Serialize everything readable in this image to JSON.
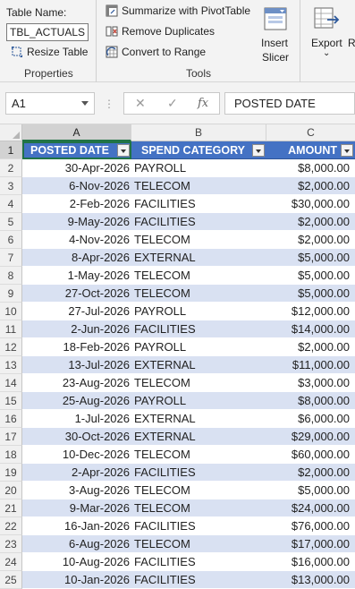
{
  "ribbon": {
    "properties": {
      "table_name_label": "Table Name:",
      "table_name_value": "TBL_ACTUALS",
      "resize_label": "Resize Table",
      "caption": "Properties"
    },
    "tools": {
      "pivot_label": "Summarize with PivotTable",
      "dupes_label": "Remove Duplicates",
      "range_label": "Convert to Range",
      "slicer_label_1": "Insert",
      "slicer_label_2": "Slicer",
      "caption": "Tools"
    },
    "export": {
      "export_label": "Export",
      "refresh_partial": "R"
    }
  },
  "formula_bar": {
    "name_box": "A1",
    "cancel_icon": "✕",
    "enter_icon": "✓",
    "fx_label": "fx",
    "content": "POSTED DATE"
  },
  "grid": {
    "columns": [
      "A",
      "B",
      "C"
    ],
    "header_row_num": "1",
    "headers": [
      "POSTED DATE",
      "SPEND CATEGORY",
      "AMOUNT"
    ],
    "rows": [
      {
        "num": "2",
        "date": "30-Apr-2026",
        "category": "PAYROLL",
        "amount": "$8,000.00"
      },
      {
        "num": "3",
        "date": "6-Nov-2026",
        "category": "TELECOM",
        "amount": "$2,000.00"
      },
      {
        "num": "4",
        "date": "2-Feb-2026",
        "category": "FACILITIES",
        "amount": "$30,000.00"
      },
      {
        "num": "5",
        "date": "9-May-2026",
        "category": "FACILITIES",
        "amount": "$2,000.00"
      },
      {
        "num": "6",
        "date": "4-Nov-2026",
        "category": "TELECOM",
        "amount": "$2,000.00"
      },
      {
        "num": "7",
        "date": "8-Apr-2026",
        "category": "EXTERNAL",
        "amount": "$5,000.00"
      },
      {
        "num": "8",
        "date": "1-May-2026",
        "category": "TELECOM",
        "amount": "$5,000.00"
      },
      {
        "num": "9",
        "date": "27-Oct-2026",
        "category": "TELECOM",
        "amount": "$5,000.00"
      },
      {
        "num": "10",
        "date": "27-Jul-2026",
        "category": "PAYROLL",
        "amount": "$12,000.00"
      },
      {
        "num": "11",
        "date": "2-Jun-2026",
        "category": "FACILITIES",
        "amount": "$14,000.00"
      },
      {
        "num": "12",
        "date": "18-Feb-2026",
        "category": "PAYROLL",
        "amount": "$2,000.00"
      },
      {
        "num": "13",
        "date": "13-Jul-2026",
        "category": "EXTERNAL",
        "amount": "$11,000.00"
      },
      {
        "num": "14",
        "date": "23-Aug-2026",
        "category": "TELECOM",
        "amount": "$3,000.00"
      },
      {
        "num": "15",
        "date": "25-Aug-2026",
        "category": "PAYROLL",
        "amount": "$8,000.00"
      },
      {
        "num": "16",
        "date": "1-Jul-2026",
        "category": "EXTERNAL",
        "amount": "$6,000.00"
      },
      {
        "num": "17",
        "date": "30-Oct-2026",
        "category": "EXTERNAL",
        "amount": "$29,000.00"
      },
      {
        "num": "18",
        "date": "10-Dec-2026",
        "category": "TELECOM",
        "amount": "$60,000.00"
      },
      {
        "num": "19",
        "date": "2-Apr-2026",
        "category": "FACILITIES",
        "amount": "$2,000.00"
      },
      {
        "num": "20",
        "date": "3-Aug-2026",
        "category": "TELECOM",
        "amount": "$5,000.00"
      },
      {
        "num": "21",
        "date": "9-Mar-2026",
        "category": "TELECOM",
        "amount": "$24,000.00"
      },
      {
        "num": "22",
        "date": "16-Jan-2026",
        "category": "FACILITIES",
        "amount": "$76,000.00"
      },
      {
        "num": "23",
        "date": "6-Aug-2026",
        "category": "TELECOM",
        "amount": "$17,000.00"
      },
      {
        "num": "24",
        "date": "10-Aug-2026",
        "category": "FACILITIES",
        "amount": "$16,000.00"
      },
      {
        "num": "25",
        "date": "10-Jan-2026",
        "category": "FACILITIES",
        "amount": "$13,000.00"
      }
    ]
  },
  "colors": {
    "header_fill": "#4472c4",
    "band_fill": "#d9e1f2",
    "selection_green": "#217346"
  }
}
